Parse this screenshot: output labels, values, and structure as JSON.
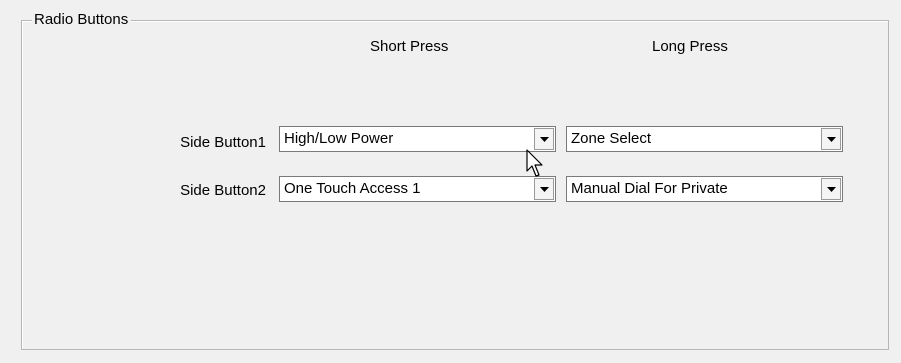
{
  "group": {
    "title": "Radio Buttons"
  },
  "headers": {
    "short_press": "Short Press",
    "long_press": "Long Press"
  },
  "rows": [
    {
      "label": "Side Button1",
      "short_press_value": "High/Low Power",
      "long_press_value": "Zone Select"
    },
    {
      "label": "Side Button2",
      "short_press_value": "One Touch Access 1",
      "long_press_value": "Manual Dial For Private"
    }
  ],
  "icons": {
    "dropdown": "chevron-down-icon",
    "cursor": "mouse-pointer-icon"
  },
  "colors": {
    "background": "#f0f0f0",
    "border": "#b6b6b6",
    "field": "#ffffff"
  }
}
